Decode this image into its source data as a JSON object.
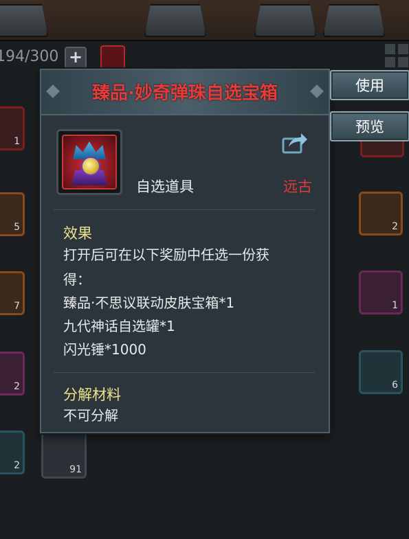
{
  "inventory": {
    "capacity": "194/300",
    "slots": [
      {
        "count": "1"
      },
      {
        "count": "5"
      },
      {
        "count": "7"
      },
      {
        "count": "2"
      },
      {
        "count": "2"
      },
      {
        "count": "91"
      },
      {
        "count": "2"
      },
      {
        "count": "1"
      },
      {
        "count": "6"
      }
    ]
  },
  "popup": {
    "title": "臻品·妙奇弹珠自选宝箱",
    "item_type": "自选道具",
    "rarity": "远古",
    "effect_title": "效果",
    "effect_lines": [
      "打开后可在以下奖励中任选一份获",
      "得：",
      "臻品·不思议联动皮肤宝箱*1",
      "九代神话自选罐*1",
      "闪光锤*1000"
    ],
    "decompose_title": "分解材料",
    "decompose_text": "不可分解"
  },
  "actions": {
    "use_label": "使用",
    "preview_label": "预览"
  },
  "colors": {
    "title": "#e23c3c",
    "rarity": "#e23a3a",
    "section_title": "#f1e08a"
  }
}
